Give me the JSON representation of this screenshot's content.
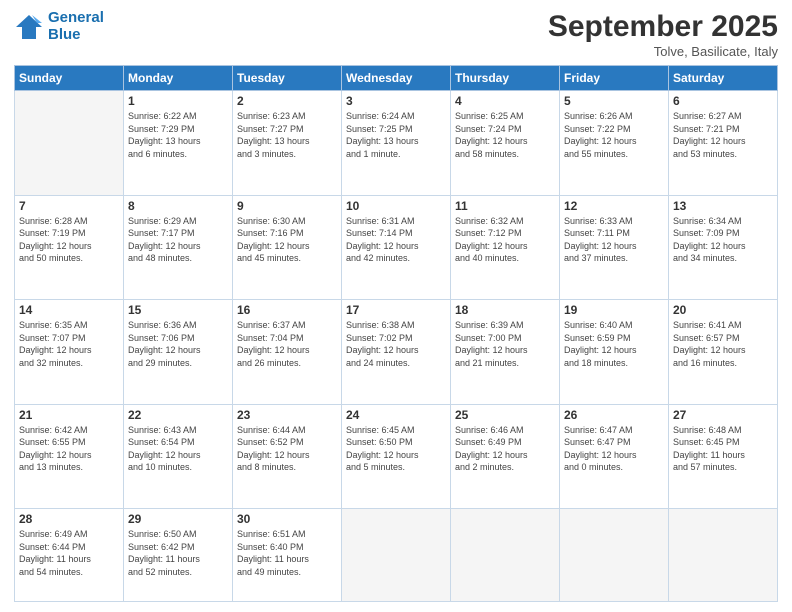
{
  "header": {
    "logo_line1": "General",
    "logo_line2": "Blue",
    "month": "September 2025",
    "location": "Tolve, Basilicate, Italy"
  },
  "days_of_week": [
    "Sunday",
    "Monday",
    "Tuesday",
    "Wednesday",
    "Thursday",
    "Friday",
    "Saturday"
  ],
  "weeks": [
    [
      {
        "day": "",
        "info": ""
      },
      {
        "day": "1",
        "info": "Sunrise: 6:22 AM\nSunset: 7:29 PM\nDaylight: 13 hours\nand 6 minutes."
      },
      {
        "day": "2",
        "info": "Sunrise: 6:23 AM\nSunset: 7:27 PM\nDaylight: 13 hours\nand 3 minutes."
      },
      {
        "day": "3",
        "info": "Sunrise: 6:24 AM\nSunset: 7:25 PM\nDaylight: 13 hours\nand 1 minute."
      },
      {
        "day": "4",
        "info": "Sunrise: 6:25 AM\nSunset: 7:24 PM\nDaylight: 12 hours\nand 58 minutes."
      },
      {
        "day": "5",
        "info": "Sunrise: 6:26 AM\nSunset: 7:22 PM\nDaylight: 12 hours\nand 55 minutes."
      },
      {
        "day": "6",
        "info": "Sunrise: 6:27 AM\nSunset: 7:21 PM\nDaylight: 12 hours\nand 53 minutes."
      }
    ],
    [
      {
        "day": "7",
        "info": "Sunrise: 6:28 AM\nSunset: 7:19 PM\nDaylight: 12 hours\nand 50 minutes."
      },
      {
        "day": "8",
        "info": "Sunrise: 6:29 AM\nSunset: 7:17 PM\nDaylight: 12 hours\nand 48 minutes."
      },
      {
        "day": "9",
        "info": "Sunrise: 6:30 AM\nSunset: 7:16 PM\nDaylight: 12 hours\nand 45 minutes."
      },
      {
        "day": "10",
        "info": "Sunrise: 6:31 AM\nSunset: 7:14 PM\nDaylight: 12 hours\nand 42 minutes."
      },
      {
        "day": "11",
        "info": "Sunrise: 6:32 AM\nSunset: 7:12 PM\nDaylight: 12 hours\nand 40 minutes."
      },
      {
        "day": "12",
        "info": "Sunrise: 6:33 AM\nSunset: 7:11 PM\nDaylight: 12 hours\nand 37 minutes."
      },
      {
        "day": "13",
        "info": "Sunrise: 6:34 AM\nSunset: 7:09 PM\nDaylight: 12 hours\nand 34 minutes."
      }
    ],
    [
      {
        "day": "14",
        "info": "Sunrise: 6:35 AM\nSunset: 7:07 PM\nDaylight: 12 hours\nand 32 minutes."
      },
      {
        "day": "15",
        "info": "Sunrise: 6:36 AM\nSunset: 7:06 PM\nDaylight: 12 hours\nand 29 minutes."
      },
      {
        "day": "16",
        "info": "Sunrise: 6:37 AM\nSunset: 7:04 PM\nDaylight: 12 hours\nand 26 minutes."
      },
      {
        "day": "17",
        "info": "Sunrise: 6:38 AM\nSunset: 7:02 PM\nDaylight: 12 hours\nand 24 minutes."
      },
      {
        "day": "18",
        "info": "Sunrise: 6:39 AM\nSunset: 7:00 PM\nDaylight: 12 hours\nand 21 minutes."
      },
      {
        "day": "19",
        "info": "Sunrise: 6:40 AM\nSunset: 6:59 PM\nDaylight: 12 hours\nand 18 minutes."
      },
      {
        "day": "20",
        "info": "Sunrise: 6:41 AM\nSunset: 6:57 PM\nDaylight: 12 hours\nand 16 minutes."
      }
    ],
    [
      {
        "day": "21",
        "info": "Sunrise: 6:42 AM\nSunset: 6:55 PM\nDaylight: 12 hours\nand 13 minutes."
      },
      {
        "day": "22",
        "info": "Sunrise: 6:43 AM\nSunset: 6:54 PM\nDaylight: 12 hours\nand 10 minutes."
      },
      {
        "day": "23",
        "info": "Sunrise: 6:44 AM\nSunset: 6:52 PM\nDaylight: 12 hours\nand 8 minutes."
      },
      {
        "day": "24",
        "info": "Sunrise: 6:45 AM\nSunset: 6:50 PM\nDaylight: 12 hours\nand 5 minutes."
      },
      {
        "day": "25",
        "info": "Sunrise: 6:46 AM\nSunset: 6:49 PM\nDaylight: 12 hours\nand 2 minutes."
      },
      {
        "day": "26",
        "info": "Sunrise: 6:47 AM\nSunset: 6:47 PM\nDaylight: 12 hours\nand 0 minutes."
      },
      {
        "day": "27",
        "info": "Sunrise: 6:48 AM\nSunset: 6:45 PM\nDaylight: 11 hours\nand 57 minutes."
      }
    ],
    [
      {
        "day": "28",
        "info": "Sunrise: 6:49 AM\nSunset: 6:44 PM\nDaylight: 11 hours\nand 54 minutes."
      },
      {
        "day": "29",
        "info": "Sunrise: 6:50 AM\nSunset: 6:42 PM\nDaylight: 11 hours\nand 52 minutes."
      },
      {
        "day": "30",
        "info": "Sunrise: 6:51 AM\nSunset: 6:40 PM\nDaylight: 11 hours\nand 49 minutes."
      },
      {
        "day": "",
        "info": ""
      },
      {
        "day": "",
        "info": ""
      },
      {
        "day": "",
        "info": ""
      },
      {
        "day": "",
        "info": ""
      }
    ]
  ]
}
